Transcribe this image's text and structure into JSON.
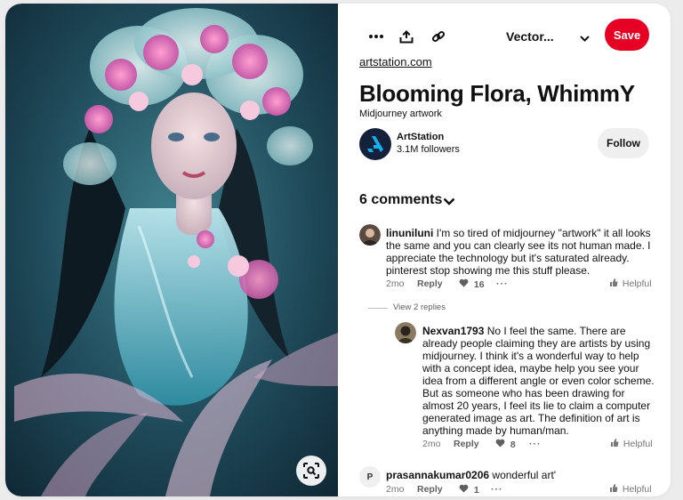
{
  "toolbar": {
    "more_icon": "more-horizontal-icon",
    "share_icon": "share-upload-icon",
    "link_icon": "link-icon",
    "board_name": "Vector...",
    "save_label": "Save",
    "accent_color": "#e60023"
  },
  "pin": {
    "source": "artstation.com",
    "title": "Blooming Flora, WhimmY",
    "subtitle": "Midjourney artwork"
  },
  "creator": {
    "name": "ArtStation",
    "followers": "3.1M followers",
    "follow_label": "Follow"
  },
  "comments": {
    "header": "6 comments",
    "view_replies": "View 2 replies",
    "items": [
      {
        "author": "linuniluni",
        "text": "I'm so tired of midjourney \"artwork\" it all looks the same and you can clearly see its not human made. I appreciate the technology but it's saturated already. pinterest stop showing me this stuff please.",
        "time": "2mo",
        "reply": "Reply",
        "likes": "16",
        "more": "···",
        "helpful": "Helpful"
      },
      {
        "author": "Nexvan1793",
        "text": "No I feel the same. There are already people claiming they are artists by using midjourney. I think it's a wonderful way to help with a concept idea, maybe help you see your idea from a different angle or even color scheme. But as someone who has been drawing for almost 20 years, I feel its lie to claim a computer generated image as art. The definition of art is anything made by human/man.",
        "time": "2mo",
        "reply": "Reply",
        "likes": "8",
        "more": "···",
        "helpful": "Helpful"
      },
      {
        "author": "prasannakumar0206",
        "avatar_initial": "P",
        "text": "wonderful art'",
        "time": "2mo",
        "reply": "Reply",
        "likes": "1",
        "more": "···",
        "helpful": "Helpful"
      }
    ]
  }
}
